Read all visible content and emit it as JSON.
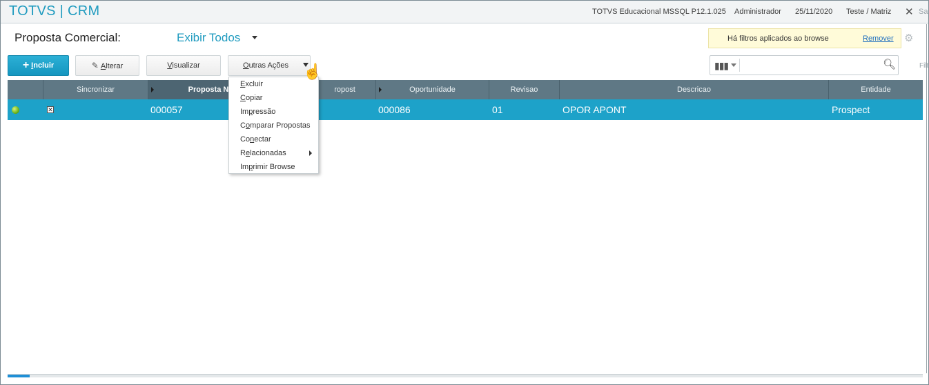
{
  "titlebar": {
    "app_title": "TOTVS | CRM",
    "environment": "TOTVS Educacional MSSQL P12.1.025",
    "user": "Administrador",
    "date": "25/11/2020",
    "branch": "Teste / Matriz",
    "close_icon": "close-icon",
    "sa": "Sa"
  },
  "header": {
    "page_title": "Proposta Comercial:",
    "view": "Exibir Todos",
    "filter_notice": "Há filtros aplicados ao browse",
    "filter_remove": "Remover",
    "filter_side_label": "Filt"
  },
  "toolbar": {
    "incluir_plus": "+",
    "incluir_first": "I",
    "incluir_rest": "ncluir",
    "alterar_first": "A",
    "alterar_rest": "lterar",
    "visualizar_first": "V",
    "visualizar_rest": "isualizar",
    "outras_first": "O",
    "outras_rest": "utras Ações"
  },
  "search": {
    "value": "",
    "placeholder": ""
  },
  "grid": {
    "columns": [
      "Sincronizar",
      "Proposta N",
      "ropost",
      "Oportunidade",
      "Revisao",
      "Descricao",
      "Entidade"
    ],
    "rows": [
      {
        "status": "active",
        "proposta": "000057",
        "oportunidade": "000086",
        "revisao": "01",
        "descricao": "OPOR APONT",
        "entidade": "Prospect"
      }
    ]
  },
  "menu": {
    "items": [
      {
        "u": "E",
        "rest": "xcluir"
      },
      {
        "u": "C",
        "rest": "opiar"
      },
      {
        "pre": "Im",
        "u": "p",
        "rest": "ressão"
      },
      {
        "pre": "C",
        "u": "o",
        "rest": "mparar Propostas"
      },
      {
        "pre": "Co",
        "u": "n",
        "rest": "ectar"
      },
      {
        "pre": "R",
        "u": "e",
        "rest": "lacionadas"
      },
      {
        "pre": "Im",
        "u": "p",
        "rest": "rimir Browse"
      }
    ]
  },
  "colors": {
    "accent": "#1f9bbf",
    "grid_header": "#5f7885",
    "selected_row": "#1da2c9",
    "filter_bg": "#fffbd9"
  }
}
